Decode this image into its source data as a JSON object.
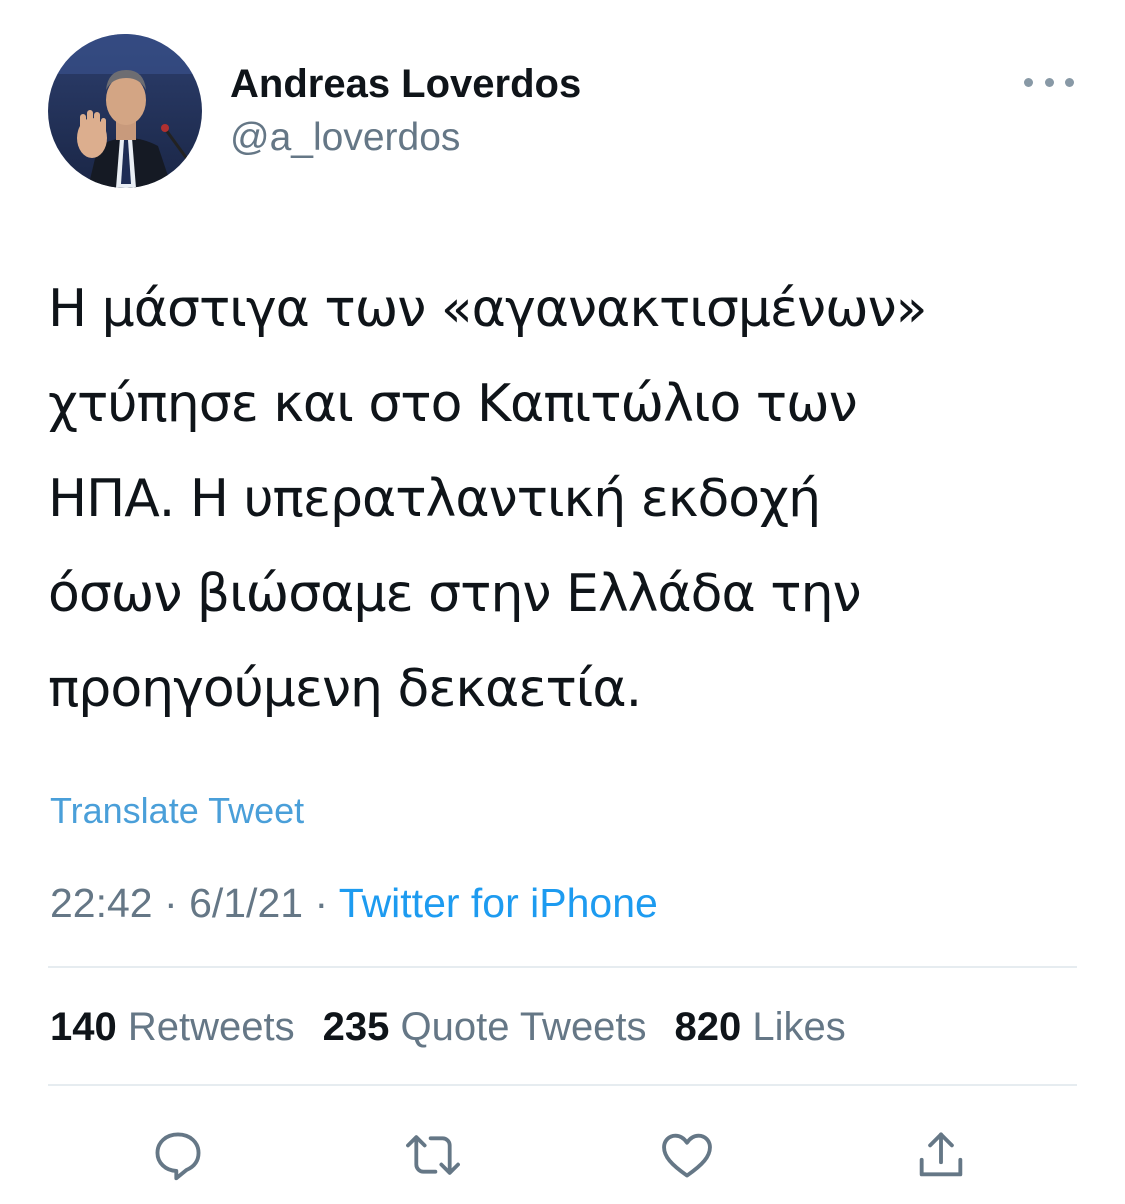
{
  "user": {
    "display_name": "Andreas Loverdos",
    "handle": "@a_loverdos"
  },
  "tweet": {
    "lines": [
      "Η μάστιγα των «αγανακτισμένων»",
      "χτύπησε και στο Καπιτώλιο των",
      "ΗΠΑ. Η υπερατλαντική εκδοχή",
      "όσων βιώσαμε στην Ελλάδα την",
      "προηγούμενη δεκαετία."
    ],
    "translate_label": "Translate Tweet",
    "time": "22:42",
    "date": "6/1/21",
    "separator": "·",
    "source": "Twitter for iPhone"
  },
  "stats": {
    "retweets": {
      "count": "140",
      "label": "Retweets"
    },
    "quotes": {
      "count": "235",
      "label": "Quote Tweets"
    },
    "likes": {
      "count": "820",
      "label": "Likes"
    }
  },
  "actions": [
    "reply-icon",
    "retweet-icon",
    "like-icon",
    "share-icon"
  ],
  "colors": {
    "text": "#0f1419",
    "secondary": "#657786",
    "link": "#1d9bf0",
    "translate": "#4a9fd9",
    "divider": "#e6ecf0",
    "icon": "#657786"
  }
}
